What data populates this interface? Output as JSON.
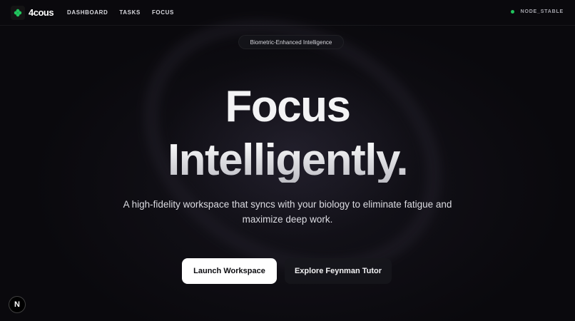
{
  "brand": {
    "name": "4cous",
    "icon": "clover-icon",
    "accent": "#21c45d"
  },
  "nav": [
    {
      "label": "DASHBOARD"
    },
    {
      "label": "TASKS"
    },
    {
      "label": "FOCUS"
    }
  ],
  "status": {
    "label": "NODE_STABLE",
    "color": "#21c45d"
  },
  "hero": {
    "badge": "Biometric-Enhanced Intelligence",
    "title_line1": "Focus",
    "title_line2": "Intelligently.",
    "subtitle": "A high-fidelity workspace that syncs with your biology to eliminate fatigue and maximize deep work.",
    "primary_cta": "Launch Workspace",
    "secondary_cta": "Explore Feynman Tutor"
  },
  "dev_indicator": {
    "label": "N",
    "icon": "nextjs-icon"
  }
}
